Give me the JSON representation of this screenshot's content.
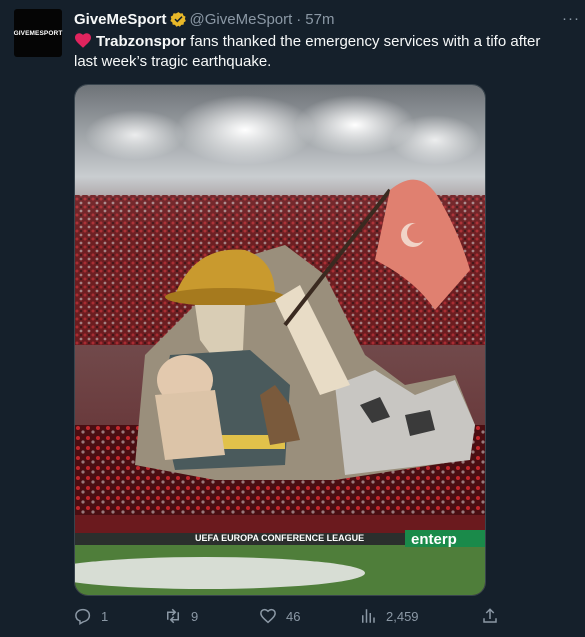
{
  "tweet": {
    "avatar_text": "GIVEMESPORT",
    "display_name": "GiveMeSport",
    "handle": "@GiveMeSport",
    "separator": "·",
    "time": "57m",
    "more": "···",
    "mention": "Trabzonspor",
    "text": " fans thanked the emergency services with a tifo after last week’s tragic earthquake.",
    "media_banner": "UEFA EUROPA CONFERENCE LEAGUE",
    "media_sponsor": "enterp"
  },
  "actions": {
    "replies": "1",
    "retweets": "9",
    "likes": "46",
    "views": "2,459"
  },
  "colors": {
    "background": "#15202b",
    "secondary_text": "#8b98a5",
    "verified_gold": "#e8b829",
    "heart_red": "#e0245e"
  }
}
